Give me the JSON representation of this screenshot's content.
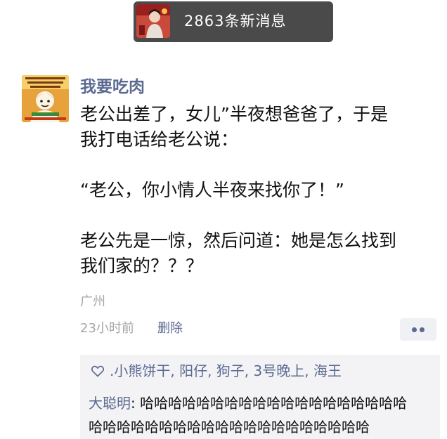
{
  "notification": {
    "text": "2863条新消息"
  },
  "post": {
    "username": "我要吃肉",
    "content_lines": [
      "老公出差了，女儿”半夜想爸爸了，于是",
      "我打电话给老公说：",
      "",
      "“老公，你小情人半夜来找你了！”",
      "",
      "老公先是一惊，然后问道：她是怎么找到",
      "我们家的？？？"
    ],
    "location": "广州",
    "time": "23小时前",
    "delete_label": "删除"
  },
  "likes": {
    "text": ".小熊饼干, 阳仔, 狗子, 3号晚上, 海王",
    "icon": "heart-icon"
  },
  "comment": {
    "author": "大聪明",
    "separator": ": ",
    "line1_text": "哈哈哈哈哈哈哈哈哈哈哈哈哈哈哈哈哈哈哈",
    "line2_text": "哈哈哈哈哈哈哈哈哈哈哈哈哈哈哈哈哈哈哈哈"
  },
  "colors": {
    "link": "#5b6a92",
    "meta": "#a6a6a6",
    "comment_bg": "#f3f3f5",
    "notification_bg": "#4a4a4a"
  }
}
